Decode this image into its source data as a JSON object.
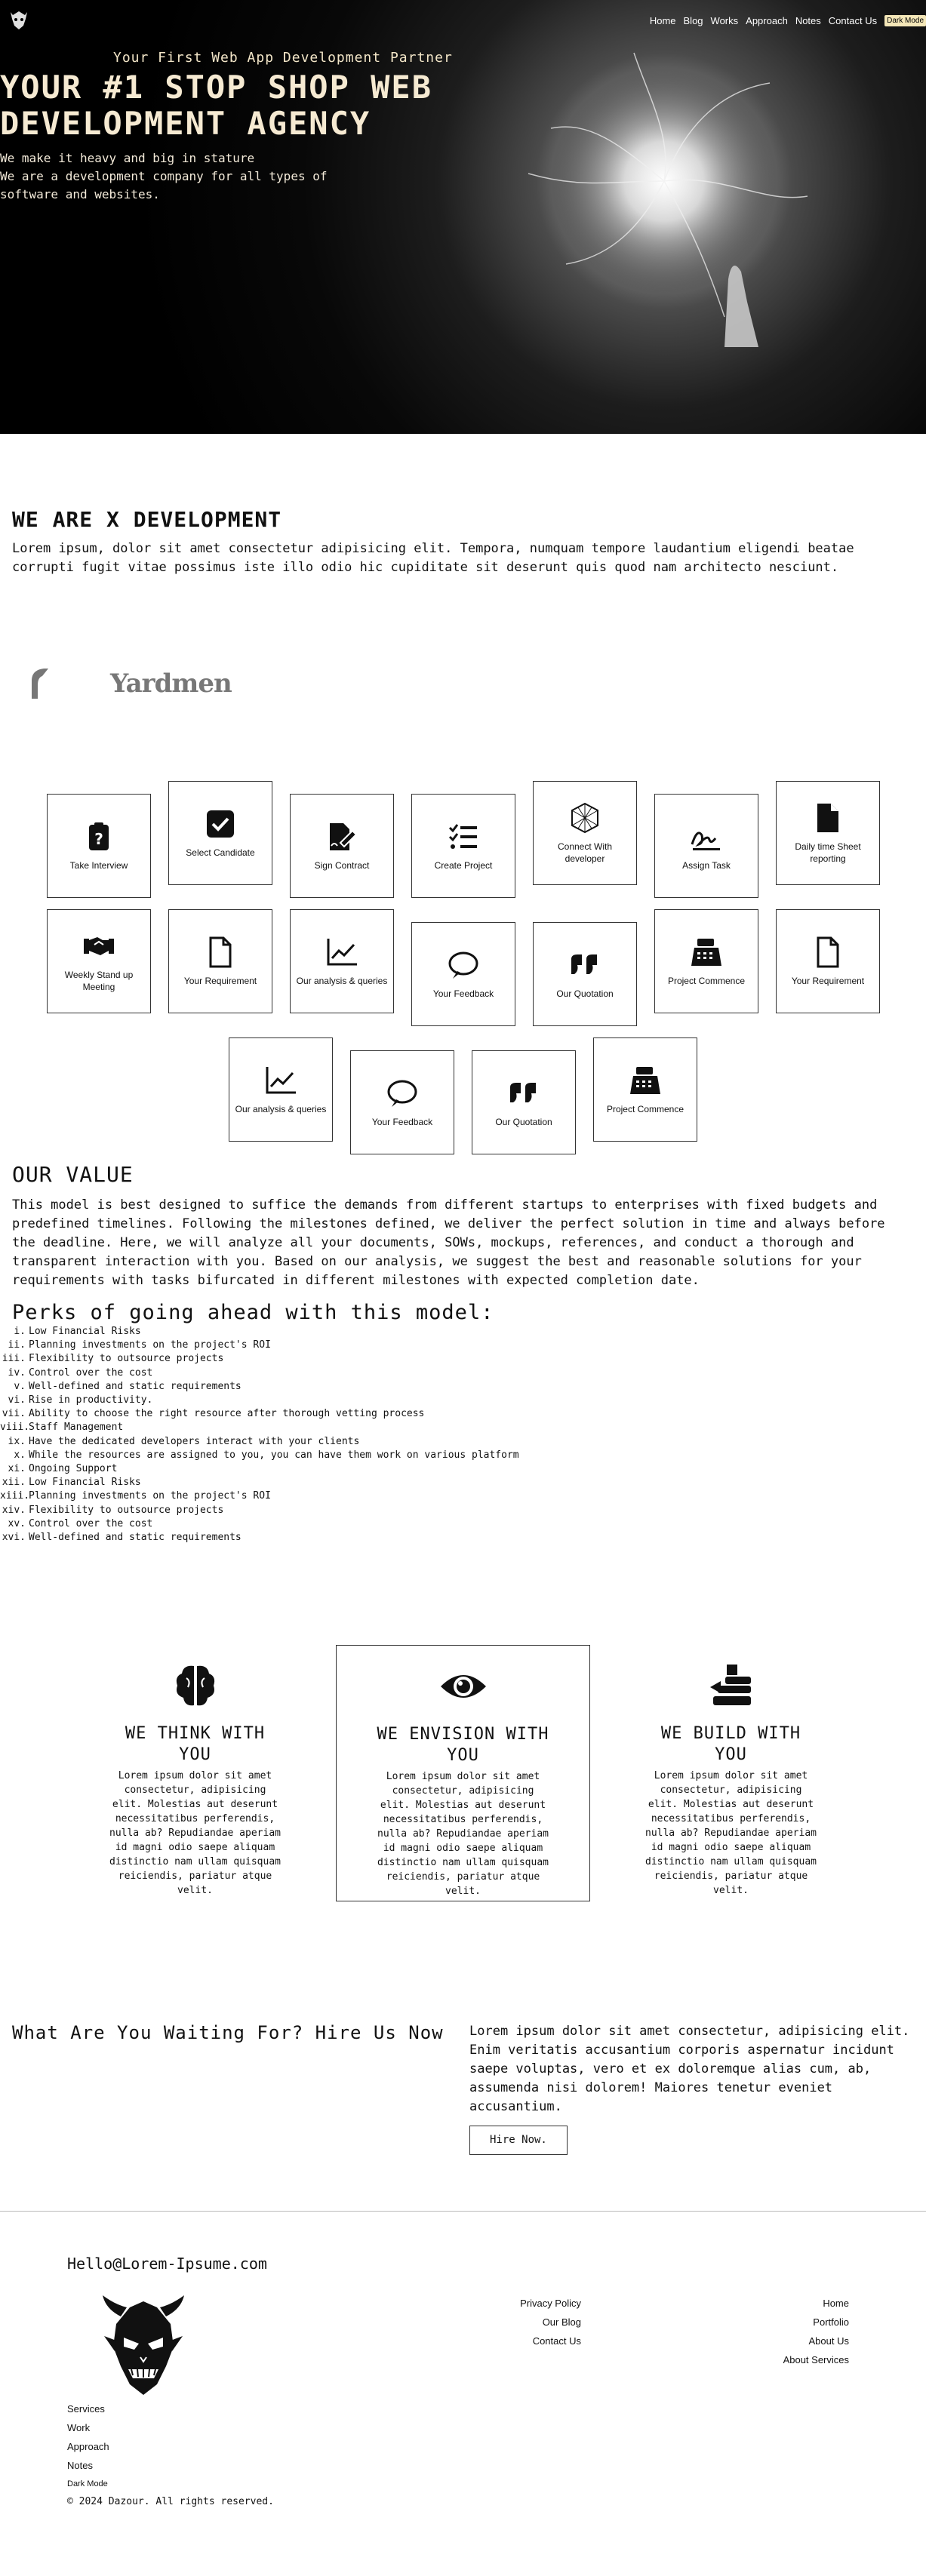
{
  "nav": {
    "items": [
      "Home",
      "Blog",
      "Works",
      "Approach",
      "Notes",
      "Contact Us"
    ],
    "dark_mode": "Dark Mode"
  },
  "hero": {
    "tagline": "Your First Web App Development Partner",
    "title": "YOUR #1 STOP SHOP WEB DEVELOPMENT AGENCY",
    "sub_line1": "We make it heavy and big in stature",
    "sub_line2": "We are a development company for all types of software and websites."
  },
  "about": {
    "title": "WE ARE X DEVELOPMENT",
    "text": "Lorem ipsum, dolor sit amet consectetur adipisicing elit. Tempora, numquam tempore laudantium eligendi beatae corrupti fugit vitae possimus iste illo odio hic cupiditate sit deserunt quis quod nam architecto nesciunt."
  },
  "partners": {
    "second": "Yardmen"
  },
  "process": {
    "row1": [
      "Take Interview",
      "Select Candidate",
      "Sign Contract",
      "Create Project",
      "Connect With developer",
      "Assign Task",
      "Daily time Sheet reporting"
    ],
    "row2": [
      "Weekly Stand up Meeting",
      "Your Requirement",
      "Our analysis & queries",
      "Your Feedback",
      "Our Quotation",
      "Project Commence",
      "Your Requirement"
    ],
    "row3": [
      "Our analysis & queries",
      "Your Feedback",
      "Our Quotation",
      "Project Commence"
    ]
  },
  "value": {
    "title": "OUR VALUE",
    "text": "This model is best designed to suffice the demands from different startups to enterprises with fixed budgets and predefined timelines. Following the milestones defined, we deliver the perfect solution in time and always before the deadline. Here, we will analyze all your documents, SOWs, mockups, references, and conduct a thorough and transparent interaction with you. Based on our analysis, we suggest the best and reasonable solutions for your requirements with tasks bifurcated in different milestones with expected completion date.",
    "perks_title": "Perks of going ahead with this model:",
    "perks": [
      {
        "n": "i.",
        "t": "Low Financial Risks"
      },
      {
        "n": "ii.",
        "t": "Planning investments on the project's ROI"
      },
      {
        "n": "iii.",
        "t": "Flexibility to outsource projects"
      },
      {
        "n": "iv.",
        "t": "Control over the cost"
      },
      {
        "n": "v.",
        "t": "Well-defined and static requirements"
      },
      {
        "n": "vi.",
        "t": "Rise in productivity."
      },
      {
        "n": "vii.",
        "t": "Ability to choose the right resource after thorough vetting process"
      },
      {
        "n": "viii.",
        "t": "Staff Management"
      },
      {
        "n": "ix.",
        "t": "Have the dedicated developers interact with your clients"
      },
      {
        "n": "x.",
        "t": "While the resources are assigned to you, you can have them work on various platform"
      },
      {
        "n": "xi.",
        "t": "Ongoing Support"
      },
      {
        "n": "xii.",
        "t": "Low Financial Risks"
      },
      {
        "n": "xiii.",
        "t": "Planning investments on the project's ROI"
      },
      {
        "n": "xiv.",
        "t": "Flexibility to outsource projects"
      },
      {
        "n": "xv.",
        "t": "Control over the cost"
      },
      {
        "n": "xvi.",
        "t": "Well-defined and static requirements"
      }
    ]
  },
  "features": [
    {
      "title": "WE THINK WITH YOU",
      "text": "Lorem ipsum dolor sit amet consectetur, adipisicing elit. Molestias aut deserunt necessitatibus perferendis, nulla ab? Repudiandae aperiam id magni odio saepe aliquam distinctio nam ullam quisquam reiciendis, pariatur atque velit.",
      "icon": "brain-icon"
    },
    {
      "title": "WE ENVISION WITH YOU",
      "text": "Lorem ipsum dolor sit amet consectetur, adipisicing elit. Molestias aut deserunt necessitatibus perferendis, nulla ab? Repudiandae aperiam id magni odio saepe aliquam distinctio nam ullam quisquam reiciendis, pariatur atque velit.",
      "icon": "eye-icon"
    },
    {
      "title": "WE BUILD WITH YOU",
      "text": "Lorem ipsum dolor sit amet consectetur, adipisicing elit. Molestias aut deserunt necessitatibus perferendis, nulla ab? Repudiandae aperiam id magni odio saepe aliquam distinctio nam ullam quisquam reiciendis, pariatur atque velit.",
      "icon": "building-blocks-icon"
    }
  ],
  "cta": {
    "title": "What Are You Waiting For? Hire Us Now",
    "text": "Lorem ipsum dolor sit amet consectetur, adipisicing elit. Enim veritatis accusantium corporis aspernatur incidunt saepe voluptas, vero et ex doloremque alias cum, ab, assumenda nisi dolorem! Maiores tenetur eveniet accusantium.",
    "button": "Hire Now."
  },
  "footer": {
    "email": "Hello@Lorem-Ipsume.com",
    "col_mid": [
      "Privacy Policy",
      "Our Blog",
      "Contact Us"
    ],
    "col_right": [
      "Home",
      "Portfolio",
      "About Us",
      "About Services"
    ],
    "left_links": [
      "Services",
      "Work",
      "Approach",
      "Notes"
    ],
    "dark_mode": "Dark Mode",
    "copyright": "© 2024 Dazour. All rights reserved."
  }
}
